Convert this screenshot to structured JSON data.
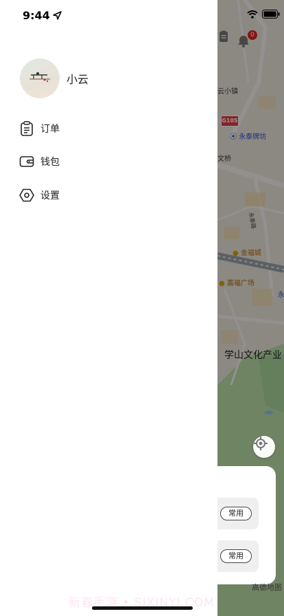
{
  "status_bar": {
    "time": "9:44",
    "location_icon": "navigation-arrow-icon",
    "signal_icon": "cellular-dots-icon",
    "wifi_icon": "wifi-icon",
    "battery_icon": "battery-icon"
  },
  "drawer": {
    "profile": {
      "name": "小云",
      "avatar_icon": "avatar-image"
    },
    "menu": [
      {
        "label": "订单",
        "icon": "clipboard-icon"
      },
      {
        "label": "钱包",
        "icon": "wallet-icon"
      },
      {
        "label": "设置",
        "icon": "settings-hexagon-icon"
      }
    ]
  },
  "map": {
    "notification_count": "0",
    "road_badge": "G105",
    "labels": {
      "town": "云小镇",
      "poi_blue_1": "永泰牌坊",
      "bridge": "文桥",
      "road_vertical": "永泰路",
      "poi_orange_1": "金福城",
      "poi_orange_2": "嘉福广场",
      "poi_blue_2": "永",
      "district": "学山文化产业"
    },
    "address_chips": [
      "常用",
      "常用"
    ],
    "map_provider": "高德地图",
    "colors": {
      "map_base": "#e9e4da",
      "park": "#b9dca6",
      "badge": "#e02424"
    }
  },
  "watermark": "新春手游 • SIXINYI.COM"
}
